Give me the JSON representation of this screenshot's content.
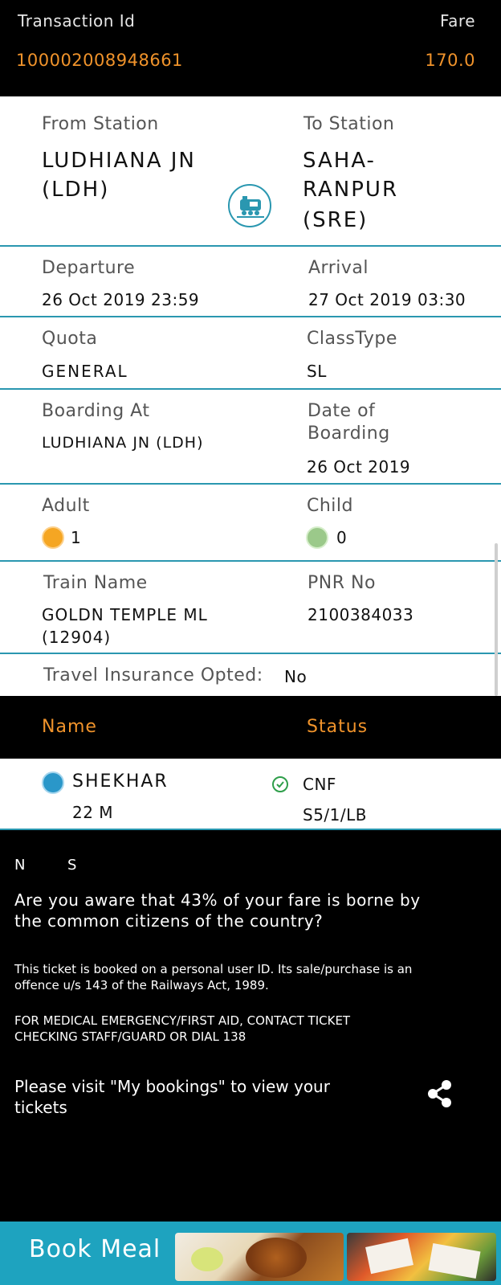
{
  "header": {
    "transaction_label": "Transaction Id",
    "fare_label": "Fare",
    "transaction_id": "100002008948661",
    "fare": "170.0"
  },
  "journey": {
    "from_label": "From Station",
    "to_label": "To Station",
    "from_name": "LUDHIANA JN",
    "from_code": "(LDH)",
    "to_line1": "SAHA-",
    "to_line2": "RANPUR",
    "to_code": "(SRE)"
  },
  "times": {
    "departure_label": "Departure",
    "departure": "26 Oct 2019  23:59",
    "arrival_label": "Arrival",
    "arrival": "27 Oct 2019  03:30"
  },
  "quota": {
    "quota_label": "Quota",
    "quota": "GENERAL",
    "class_label": "ClassType",
    "class": "SL"
  },
  "boarding": {
    "at_label": "Boarding At",
    "at": "LUDHIANA JN (LDH)",
    "date_label_1": "Date of",
    "date_label_2": "Boarding",
    "date": "26 Oct 2019"
  },
  "passengers_count": {
    "adult_label": "Adult",
    "adult": "1",
    "child_label": "Child",
    "child": "0"
  },
  "train": {
    "name_label": "Train Name",
    "name_line1": "GOLDN TEMPLE ML",
    "name_line2": "(12904)",
    "pnr_label": "PNR No",
    "pnr": "2100384033"
  },
  "insurance": {
    "label": "Travel Insurance Opted:",
    "value": "No"
  },
  "passenger_table": {
    "name_header": "Name",
    "status_header": "Status",
    "rows": [
      {
        "name": "SHEKHAR",
        "detail": "22 M",
        "status": "CNF",
        "berth": "S5/1/LB"
      }
    ]
  },
  "notes": {
    "ns_n": "N",
    "ns_s": "S",
    "subsidy_1": "Are you aware that 43% of your fare is borne by",
    "subsidy_2": "the common citizens of the country?",
    "personal_1": "This ticket is booked on a personal user ID. Its sale/purchase is an",
    "personal_2": "offence u/s 143 of the Railways Act, 1989.",
    "medical_1": "FOR MEDICAL EMERGENCY/FIRST AID, CONTACT TICKET",
    "medical_2": "CHECKING STAFF/GUARD OR DIAL 138",
    "visit_1": "Please visit \"My bookings\" to view your",
    "visit_2": "tickets"
  },
  "book_meal": {
    "label": "Book Meal"
  },
  "colors": {
    "accent_orange": "#f0932b",
    "teal": "#2a97b0",
    "meal_bar": "#1ea3bf"
  }
}
